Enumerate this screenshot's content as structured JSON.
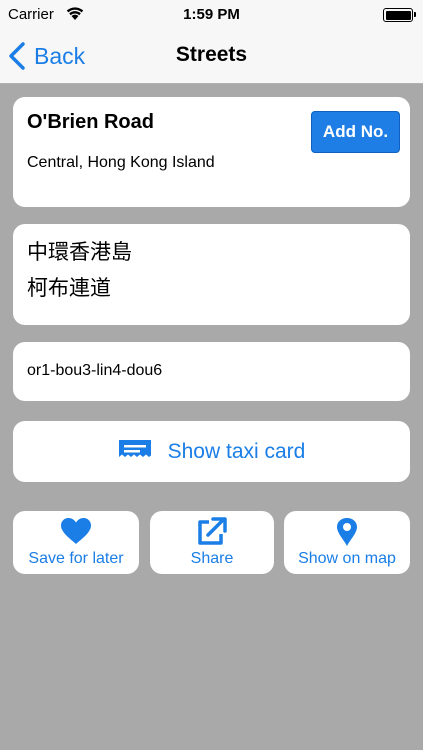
{
  "status_bar": {
    "carrier": "Carrier",
    "time": "1:59 PM"
  },
  "nav": {
    "back_label": "Back",
    "title": "Streets"
  },
  "street": {
    "name": "O'Brien Road",
    "area": "Central, Hong Kong Island",
    "add_number_label": "Add No.",
    "chinese_line_1": "中環香港島",
    "chinese_line_2": "柯布連道",
    "romanization": "or1-bou3-lin4-dou6"
  },
  "taxi_card": {
    "label": "Show taxi card",
    "icon": "taxi-card-icon"
  },
  "actions": [
    {
      "label": "Save for later",
      "icon": "heart-icon"
    },
    {
      "label": "Share",
      "icon": "share-icon"
    },
    {
      "label": "Show on map",
      "icon": "map-pin-icon"
    }
  ],
  "colors": {
    "accent": "#1a7ee6",
    "background": "#a9a9a9",
    "card": "#ffffff",
    "bar": "#f7f7f7"
  }
}
